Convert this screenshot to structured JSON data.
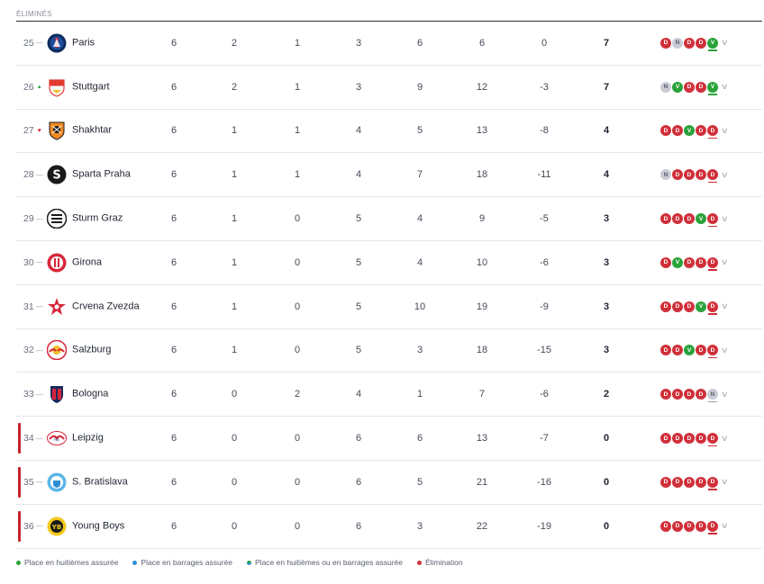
{
  "section": {
    "title": "ÉLIMINÉS"
  },
  "colors": {
    "loss": "#d0303a",
    "win": "#2aa23a",
    "draw": "#c9ccd4",
    "elimination": "#c8232c",
    "playoff": "#2d8fd6"
  },
  "rows": [
    {
      "rank": "25",
      "trend": "same",
      "team": "Paris",
      "crest": "paris-crest",
      "played": "6",
      "won": "2",
      "drawn": "1",
      "lost": "3",
      "gf": "6",
      "ga": "6",
      "gd": "0",
      "pts": "7",
      "form": [
        "D",
        "N",
        "D",
        "D",
        "V"
      ],
      "elim": false
    },
    {
      "rank": "26",
      "trend": "up",
      "team": "Stuttgart",
      "crest": "stuttgart-crest",
      "played": "6",
      "won": "2",
      "drawn": "1",
      "lost": "3",
      "gf": "9",
      "ga": "12",
      "gd": "-3",
      "pts": "7",
      "form": [
        "N",
        "V",
        "D",
        "D",
        "V"
      ],
      "elim": false
    },
    {
      "rank": "27",
      "trend": "down",
      "team": "Shakhtar",
      "crest": "shakhtar-crest",
      "played": "6",
      "won": "1",
      "drawn": "1",
      "lost": "4",
      "gf": "5",
      "ga": "13",
      "gd": "-8",
      "pts": "4",
      "form": [
        "D",
        "D",
        "V",
        "D",
        "D"
      ],
      "elim": false
    },
    {
      "rank": "28",
      "trend": "same",
      "team": "Sparta Praha",
      "crest": "sparta-crest",
      "played": "6",
      "won": "1",
      "drawn": "1",
      "lost": "4",
      "gf": "7",
      "ga": "18",
      "gd": "-11",
      "pts": "4",
      "form": [
        "N",
        "D",
        "D",
        "D",
        "D"
      ],
      "elim": false
    },
    {
      "rank": "29",
      "trend": "same",
      "team": "Sturm Graz",
      "crest": "sturm-crest",
      "played": "6",
      "won": "1",
      "drawn": "0",
      "lost": "5",
      "gf": "4",
      "ga": "9",
      "gd": "-5",
      "pts": "3",
      "form": [
        "D",
        "D",
        "D",
        "V",
        "D"
      ],
      "elim": false
    },
    {
      "rank": "30",
      "trend": "same",
      "team": "Girona",
      "crest": "girona-crest",
      "played": "6",
      "won": "1",
      "drawn": "0",
      "lost": "5",
      "gf": "4",
      "ga": "10",
      "gd": "-6",
      "pts": "3",
      "form": [
        "D",
        "V",
        "D",
        "D",
        "D"
      ],
      "elim": false
    },
    {
      "rank": "31",
      "trend": "same",
      "team": "Crvena Zvezda",
      "crest": "zvezda-crest",
      "played": "6",
      "won": "1",
      "drawn": "0",
      "lost": "5",
      "gf": "10",
      "ga": "19",
      "gd": "-9",
      "pts": "3",
      "form": [
        "D",
        "D",
        "D",
        "V",
        "D"
      ],
      "elim": false
    },
    {
      "rank": "32",
      "trend": "same",
      "team": "Salzburg",
      "crest": "salzburg-crest",
      "played": "6",
      "won": "1",
      "drawn": "0",
      "lost": "5",
      "gf": "3",
      "ga": "18",
      "gd": "-15",
      "pts": "3",
      "form": [
        "D",
        "D",
        "V",
        "D",
        "D"
      ],
      "elim": false
    },
    {
      "rank": "33",
      "trend": "same",
      "team": "Bologna",
      "crest": "bologna-crest",
      "played": "6",
      "won": "0",
      "drawn": "2",
      "lost": "4",
      "gf": "1",
      "ga": "7",
      "gd": "-6",
      "pts": "2",
      "form": [
        "D",
        "D",
        "D",
        "D",
        "N"
      ],
      "elim": false
    },
    {
      "rank": "34",
      "trend": "same",
      "team": "Leipzig",
      "crest": "leipzig-crest",
      "played": "6",
      "won": "0",
      "drawn": "0",
      "lost": "6",
      "gf": "6",
      "ga": "13",
      "gd": "-7",
      "pts": "0",
      "form": [
        "D",
        "D",
        "D",
        "D",
        "D"
      ],
      "elim": true
    },
    {
      "rank": "35",
      "trend": "same",
      "team": "S. Bratislava",
      "crest": "bratislava-crest",
      "played": "6",
      "won": "0",
      "drawn": "0",
      "lost": "6",
      "gf": "5",
      "ga": "21",
      "gd": "-16",
      "pts": "0",
      "form": [
        "D",
        "D",
        "D",
        "D",
        "D"
      ],
      "elim": true
    },
    {
      "rank": "36",
      "trend": "same",
      "team": "Young Boys",
      "crest": "youngboys-crest",
      "played": "6",
      "won": "0",
      "drawn": "0",
      "lost": "6",
      "gf": "3",
      "ga": "22",
      "gd": "-19",
      "pts": "0",
      "form": [
        "D",
        "D",
        "D",
        "D",
        "D"
      ],
      "elim": true
    }
  ],
  "legend": [
    {
      "kind": "q",
      "label": "Place en huitièmes assurée"
    },
    {
      "kind": "p",
      "label": "Place en barrages assurée"
    },
    {
      "kind": "qp",
      "label": "Place en huitièmes ou en barrages assurée"
    },
    {
      "kind": "e",
      "label": "Élimination"
    }
  ]
}
